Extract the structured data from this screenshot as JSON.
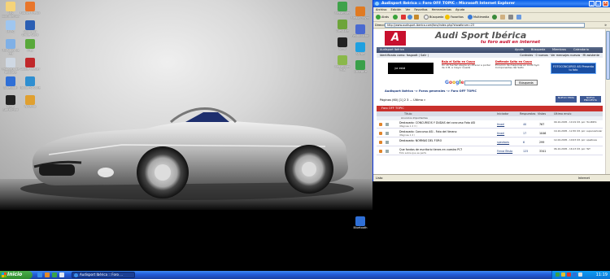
{
  "desktop": {
    "icons_left": [
      {
        "label": "Mis documentos",
        "icon": "my-documents-icon",
        "color": "#f5d37a"
      },
      {
        "label": "Mi PC",
        "icon": "my-computer-icon",
        "color": "#9fc6ef"
      },
      {
        "label": "Mis sitios de red",
        "icon": "network-places-icon",
        "color": "#7fb0e6"
      },
      {
        "label": "Papelera de reciclaje",
        "icon": "recycle-bin-icon",
        "color": "#cfd8e3"
      },
      {
        "label": "Bluetooth",
        "icon": "bluetooth-icon",
        "color": "#2f6fd6"
      },
      {
        "label": "Nero StartSmart",
        "icon": "nero-icon",
        "color": "#222222"
      },
      {
        "label": "Mozilla Firefox",
        "icon": "firefox-icon",
        "color": "#e8762b"
      },
      {
        "label": "Microsoft Office Word",
        "icon": "word-icon",
        "color": "#2b5fb3"
      },
      {
        "label": "Ares",
        "icon": "ares-icon",
        "color": "#58a83a"
      },
      {
        "label": "Adobe Reader",
        "icon": "adobe-reader-icon",
        "color": "#c0282a"
      },
      {
        "label": "Nokia PC Suite",
        "icon": "nokia-icon",
        "color": "#2f8fd1"
      },
      {
        "label": "Winamp",
        "icon": "winamp-icon",
        "color": "#e0a030"
      }
    ],
    "icons_right": [
      {
        "label": "Messenger",
        "icon": "messenger-icon",
        "color": "#3fa24a"
      },
      {
        "label": "Media Player",
        "icon": "media-player-icon",
        "color": "#e07a22"
      },
      {
        "label": "Ares Lite",
        "icon": "ares-lite-icon",
        "color": "#6da43a"
      },
      {
        "label": "Reproductor",
        "icon": "player-icon",
        "color": "#4a6ad0"
      },
      {
        "label": "Nero",
        "icon": "nero2-icon",
        "color": "#222222"
      },
      {
        "label": "Skype",
        "icon": "skype-icon",
        "color": "#1fa0e0"
      },
      {
        "label": "Messenger Plus",
        "icon": "msn-plus-icon",
        "color": "#8ab84a"
      },
      {
        "label": "Limewire",
        "icon": "limewire-icon",
        "color": "#3aa04a"
      },
      {
        "label": "Bluetooth",
        "icon": "bluetooth2-icon",
        "color": "#2f6fd6"
      }
    ]
  },
  "taskbar": {
    "start_label": "Inicio",
    "task_label": "Audisport Ibérica :: Foro ...",
    "clock": "11:19"
  },
  "browser": {
    "title": "Audisport Ibérica :: Foro OFF TOPIC - Microsoft Internet Explorer",
    "menu": [
      "Archivo",
      "Edición",
      "Ver",
      "Favoritos",
      "Herramientas",
      "Ayuda"
    ],
    "toolbar": {
      "back": "Atrás",
      "search": "Búsqueda",
      "favorites": "Favoritos",
      "multimedia": "Multimedia"
    },
    "address_label": "Dirección",
    "address_value": "http://www.audisport-iberica.com/foro/index.php?showforum=23",
    "go_label": "Ir",
    "status_text": "Listo",
    "status_zone": "Internet"
  },
  "page": {
    "site_name": "Audi Sport Ibérica",
    "tagline": "tu foro audi en internet",
    "nav": {
      "left": "Audisport Ibérica",
      "help": "Ayuda",
      "search": "Búsqueda",
      "members": "Miembros",
      "calendar": "Calendario"
    },
    "id_text": "Identificado como: fasgoatt ( Salir )",
    "id_right": "Controles · 0 nuevos · Ver mensajes nuevos · Mi asistente",
    "ad_black": "ya está",
    "ad1_title": "Baja el Salto en Casco",
    "ad1_body": "Un ob fue tan alegre en ofrecer a portal de 4 M, a mayor Quedé",
    "ad2_title": "Defiende Salto en Casco",
    "ad2_body": "Emoción de maquinas en Audit Sym Componentes del Salto",
    "ad_blue": "FOTOCONCURSO ASI Presenta tu foto",
    "google_logo": "Google",
    "google_button": "Búsqueda",
    "breadcrumb": "Audisport Ibérica -> Foros generales -> Foro OFF TOPIC",
    "pages": "Páginas (60) [1] 2 3 ... Último »",
    "btn_new": "NUEVO TEMA",
    "btn_poll": "NUEVA ENCUESTA",
    "forum_header": "Foro OFF TOPIC",
    "columns": {
      "title": "Título",
      "author": "Iniciador",
      "replies": "Respuestas",
      "views": "Vistas",
      "last": "Último envío"
    },
    "announcements": "Anuncios Importantes",
    "topics": [
      {
        "title": "Destacado: CONCURSOS Y DUDAS del concurso Foto ASI",
        "sub": "(Páginas 1 2 3 )",
        "author": "Ikrael",
        "replies": "40",
        "views": "767",
        "last": "09-10-2005 - 10:19 Últ. por: Toni6951"
      },
      {
        "title": "Destacado: Concurso ASI - Foto del Verano",
        "sub": "(Páginas 1 2 )",
        "author": "Ikrael",
        "replies": "17",
        "views": "1046",
        "last": "10-10-2005 - 12:30 Últ. por: superverkoler"
      },
      {
        "title": "Destacado: NORMAS DEL FORO",
        "sub": "",
        "author": "spezkoes",
        "replies": "6",
        "views": "299",
        "last": "12-02-2005 - 10:03 Últ. por: spezkoes"
      },
      {
        "title": "Que fondos de escritorio tienes en vuestro PC?",
        "sub": "Foto sobre que es perfe",
        "author": "FerrariTesta",
        "replies": "125",
        "views": "3341",
        "last": "06-10-2005 - 16:13 Últ. por: TaT"
      }
    ]
  }
}
